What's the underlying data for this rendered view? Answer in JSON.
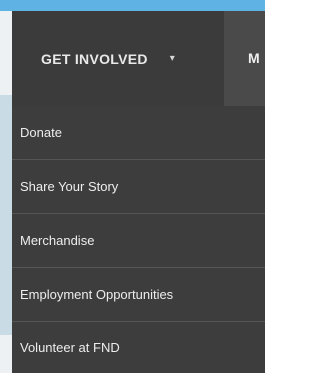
{
  "colors": {
    "top_strip": "#5fb3e4",
    "nav_bg": "#4a4a4a",
    "nav_active_bg": "#3b3b3b",
    "dropdown_bg": "#3d3d3d",
    "divider": "#555555",
    "text": "#ededed"
  },
  "nav": {
    "active_label": "GET INVOLVED",
    "caret_icon": "caret-down-icon",
    "next_label_partial": "M"
  },
  "dropdown": {
    "items": [
      {
        "label": "Donate"
      },
      {
        "label": "Share Your Story"
      },
      {
        "label": "Merchandise"
      },
      {
        "label": "Employment Opportunities"
      },
      {
        "label": "Volunteer at FND"
      }
    ]
  }
}
